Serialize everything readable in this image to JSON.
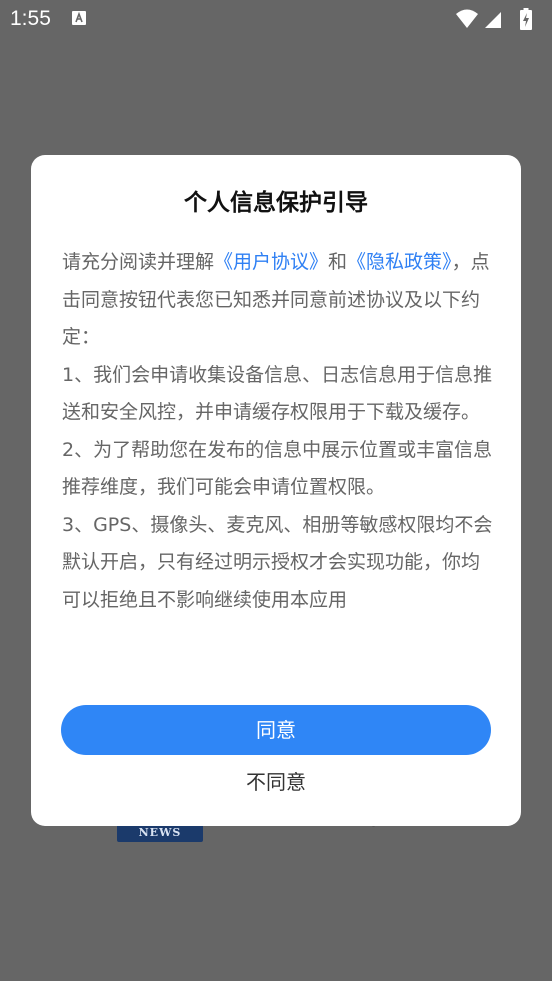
{
  "status_bar": {
    "time": "1:55",
    "icons": [
      "notification-a-icon",
      "wifi-icon",
      "signal-icon",
      "battery-charging-icon"
    ]
  },
  "background": {
    "logo_text": "NEWS"
  },
  "dialog": {
    "title": "个人信息保护引导",
    "intro_pre": "请充分阅读并理解",
    "user_agreement_link": "《用户协议》",
    "and_text": "和",
    "privacy_policy_link": "《隐私政策》",
    "intro_post": "，点击同意按钮代表您已知悉并同意前述协议及以下约定：",
    "clause_1": "1、我们会申请收集设备信息、日志信息用于信息推送和安全风控，并申请缓存权限用于下载及缓存。",
    "clause_2": "2、为了帮助您在发布的信息中展示位置或丰富信息推荐维度，我们可能会申请位置权限。",
    "clause_3": "3、GPS、摄像头、麦克风、相册等敏感权限均不会默认开启，只有经过明示授权才会实现功能，你均可以拒绝且不影响继续使用本应用",
    "agree_label": "同意",
    "disagree_label": "不同意"
  },
  "colors": {
    "overlay": "#666666",
    "link": "#2f80f4",
    "primary_button": "#2f86f6"
  }
}
